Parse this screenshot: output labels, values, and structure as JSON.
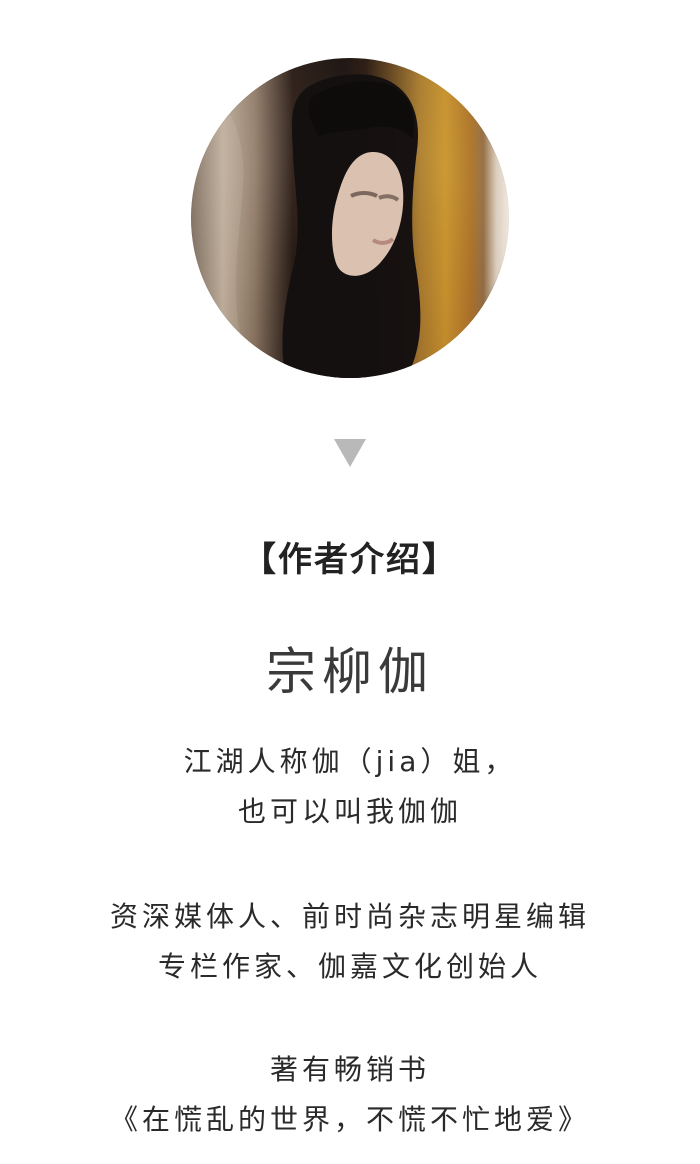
{
  "avatar": {
    "icon": "author-portrait-image"
  },
  "indicator": {
    "icon": "down-triangle-icon",
    "color": "#b9b9b9"
  },
  "section": {
    "title": "【作者介绍】"
  },
  "author": {
    "name": "宗柳伽",
    "lines": [
      "江湖人称伽（jia）姐，",
      "也可以叫我伽伽",
      "资深媒体人、前时尚杂志明星编辑",
      "专栏作家、伽嘉文化创始人",
      "著有畅销书",
      "《在慌乱的世界，不慌不忙地爱》"
    ]
  }
}
